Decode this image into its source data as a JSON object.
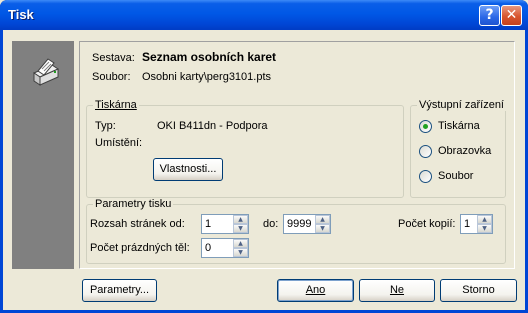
{
  "window": {
    "title": "Tisk",
    "help_label": "?",
    "close_label": "✕"
  },
  "report": {
    "sestava_label": "Sestava:",
    "sestava_value": "Seznam osobních karet",
    "soubor_label": "Soubor:",
    "soubor_value": "Osobni karty\\perg3101.pts"
  },
  "printer": {
    "group_title": "Tiskárna",
    "typ_label": "Typ:",
    "typ_value": "OKI B411dn - Podpora",
    "umisteni_label": "Umístění:",
    "umisteni_value": "",
    "properties_button": "Vlastnosti..."
  },
  "output": {
    "group_title": "Výstupní zařízení",
    "options": [
      {
        "label": "Tiskárna",
        "selected": true
      },
      {
        "label": "Obrazovka",
        "selected": false
      },
      {
        "label": "Soubor",
        "selected": false
      }
    ]
  },
  "params": {
    "group_title": "Parametry tisku",
    "range_label": "Rozsah stránek od:",
    "from_value": "1",
    "to_label": "do:",
    "to_value": "9999",
    "copies_label": "Počet kopií:",
    "copies_value": "1",
    "blank_label": "Počet prázdných těl:",
    "blank_value": "0"
  },
  "buttons": {
    "parametry": "Parametry...",
    "ano": "Ano",
    "ne": "Ne",
    "storno": "Storno"
  }
}
